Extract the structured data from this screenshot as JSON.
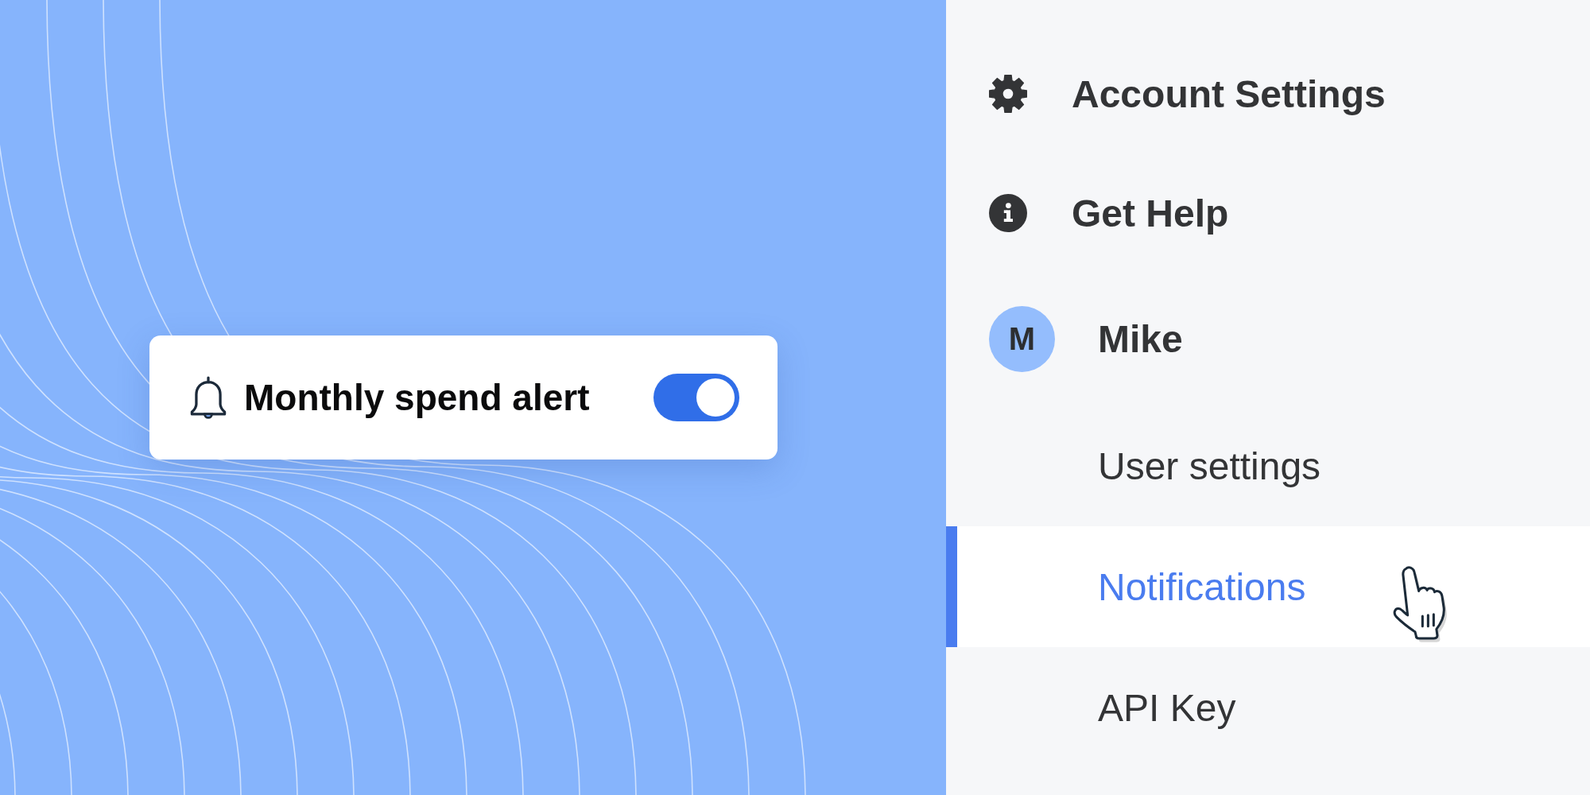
{
  "alert_card": {
    "label": "Monthly spend alert",
    "toggle": {
      "on": true
    }
  },
  "sidebar": {
    "menu": [
      {
        "label": "Account Settings"
      },
      {
        "label": "Get Help"
      }
    ],
    "user": {
      "initial": "M",
      "name": "Mike"
    },
    "items": [
      {
        "label": "User settings",
        "selected": false
      },
      {
        "label": "Notifications",
        "selected": true
      },
      {
        "label": "API Key",
        "selected": false
      }
    ]
  }
}
